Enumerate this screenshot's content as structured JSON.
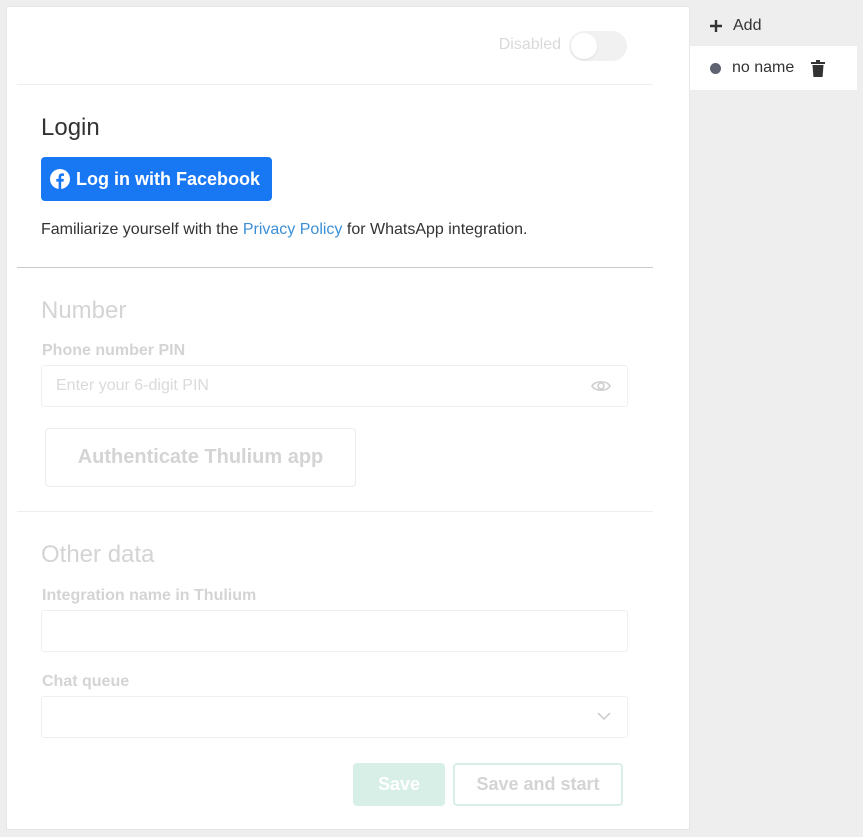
{
  "toggle": {
    "label": "Disabled",
    "enabled": false
  },
  "login": {
    "title": "Login",
    "facebook_button": "Log in with Facebook",
    "privacy_prefix": "Familiarize yourself with the ",
    "privacy_link": "Privacy Policy",
    "privacy_suffix": " for WhatsApp integration."
  },
  "number": {
    "title": "Number",
    "pin_label": "Phone number PIN",
    "pin_placeholder": "Enter your 6-digit PIN",
    "pin_value": "",
    "auth_button": "Authenticate Thulium app"
  },
  "other": {
    "title": "Other data",
    "integration_label": "Integration name in Thulium",
    "integration_value": "",
    "queue_label": "Chat queue",
    "queue_value": ""
  },
  "actions": {
    "save": "Save",
    "save_and_start": "Save and start"
  },
  "sidebar": {
    "add_label": "Add",
    "items": [
      {
        "label": "no name"
      }
    ]
  },
  "colors": {
    "facebook": "#1877f2",
    "link": "#3b8fd6",
    "save_disabled": "#d7efe6",
    "status_dot": "#5f6270"
  }
}
